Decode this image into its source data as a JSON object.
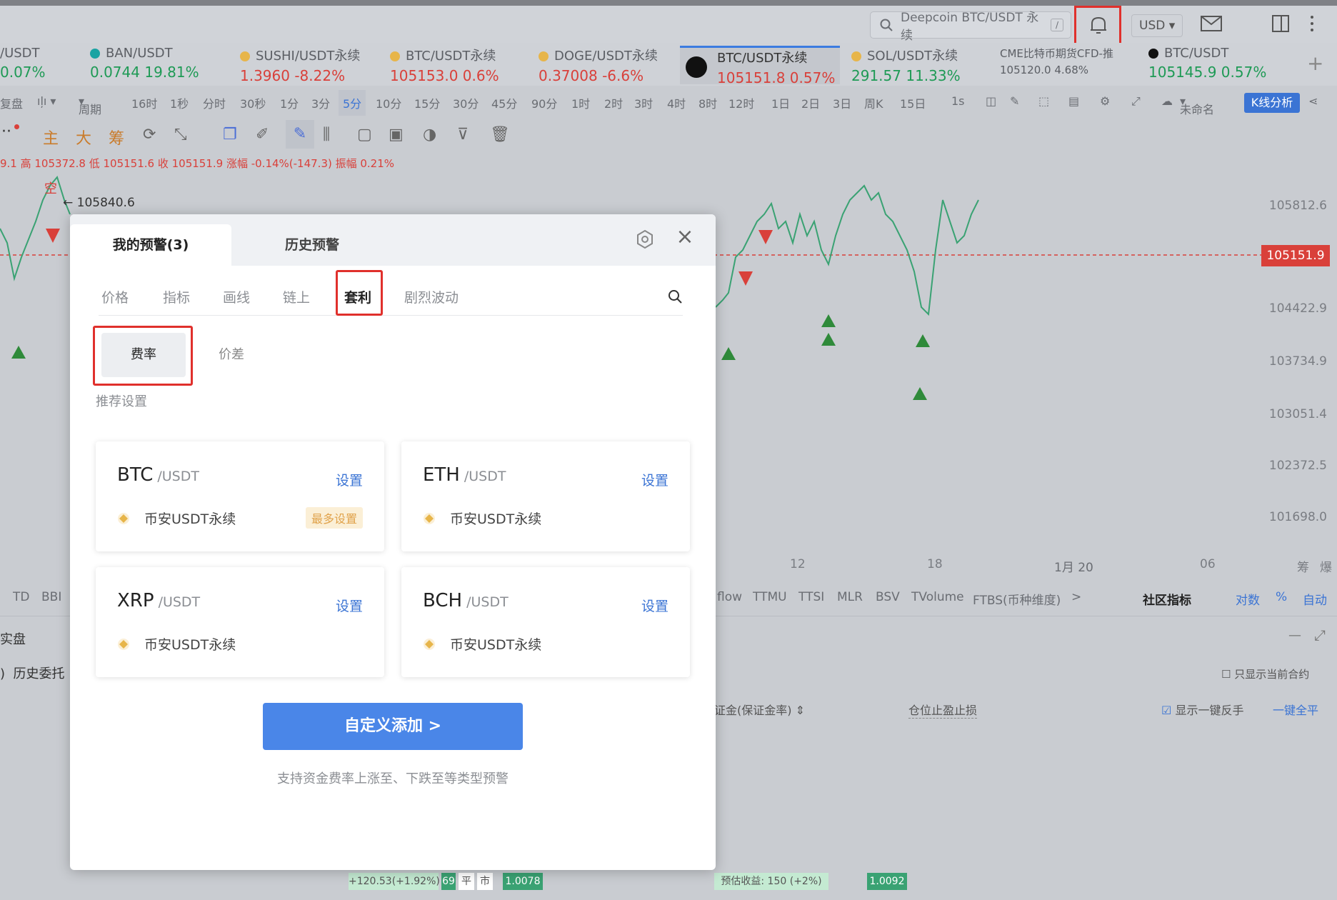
{
  "search": {
    "placeholder": "Deepcoin BTC/USDT 永续",
    "shortcut": "/"
  },
  "currency": "USD",
  "tickers": [
    {
      "name": "/USDT",
      "price": "0.07%",
      "dir": "up"
    },
    {
      "name": "BAN/USDT",
      "price": "0.0744  19.81%",
      "dir": "up"
    },
    {
      "name": "SUSHI/USDT永续",
      "price": "1.3960  -8.22%",
      "dir": "dn"
    },
    {
      "name": "BTC/USDT永续",
      "price": "105153.0  0.6%",
      "dir": "dn"
    },
    {
      "name": "DOGE/USDT永续",
      "price": "0.37008  -6.6%",
      "dir": "dn"
    },
    {
      "name": "BTC/USDT永续",
      "price": "105151.8  0.57%",
      "dir": "dn"
    },
    {
      "name": "SOL/USDT永续",
      "price": "291.57  11.33%",
      "dir": "up"
    },
    {
      "name": "CME比特币期货CFD-推",
      "price": "105120.0  4.68%",
      "dir": "plain"
    },
    {
      "name": "BTC/USDT",
      "price": "105145.9  0.57%",
      "dir": "up"
    }
  ],
  "periods": [
    "复盘",
    "周期",
    "16时",
    "1秒",
    "分时",
    "30秒",
    "1分",
    "3分",
    "5分",
    "10分",
    "15分",
    "30分",
    "45分",
    "90分",
    "1时",
    "2时",
    "3时",
    "4时",
    "8时",
    "12时",
    "1日",
    "2日",
    "3日",
    "周K",
    "15日",
    "1s",
    "未命名",
    "K线分析"
  ],
  "toolbar": [
    "主",
    "大",
    "筹"
  ],
  "ohlc": "9.1  高 105372.8  低 105151.6  收 105151.9  涨幅 -0.14%(-147.3)  振幅 0.21%",
  "chart": {
    "marker_short": "空",
    "marker_price": "← 105840.6",
    "yticks": [
      "105812.6",
      "104422.9",
      "103734.9",
      "103051.4",
      "102372.5",
      "101698.0"
    ],
    "current_price": "105151.9",
    "xticks": [
      "12",
      "18",
      "1月 20",
      "06",
      "筹",
      "爆"
    ]
  },
  "indicators": {
    "left": [
      "TD",
      "BBI"
    ],
    "right": [
      "flow",
      "TTMU",
      "TTSI",
      "MLR",
      "BSV",
      "TVolume",
      "FTBS(币种维度)",
      ">"
    ],
    "tools": [
      "社区指标",
      "对数",
      "%",
      "自动"
    ]
  },
  "panel": {
    "title": "实盘",
    "tab": "历史委托",
    "columns": [
      "证金(保证金率)",
      "仓位止盈止损"
    ],
    "show_current": "只显示当前合约",
    "show_reverse": "显示一键反手",
    "close_all": "一键全平"
  },
  "modal": {
    "tab_my": "我的预警(3)",
    "tab_history": "历史预警",
    "subtabs": [
      "价格",
      "指标",
      "画线",
      "链上",
      "套利",
      "剧烈波动"
    ],
    "pills": [
      "费率",
      "价差"
    ],
    "recommend": "推荐设置",
    "cards": [
      {
        "sym": "BTC",
        "quote": "/USDT",
        "set": "设置",
        "exchange": "币安USDT永续",
        "badge": "最多设置"
      },
      {
        "sym": "ETH",
        "quote": "/USDT",
        "set": "设置",
        "exchange": "币安USDT永续",
        "badge": ""
      },
      {
        "sym": "XRP",
        "quote": "/USDT",
        "set": "设置",
        "exchange": "币安USDT永续",
        "badge": ""
      },
      {
        "sym": "BCH",
        "quote": "/USDT",
        "set": "设置",
        "exchange": "币安USDT永续",
        "badge": ""
      }
    ],
    "add_button": "自定义添加 >",
    "hint": "支持资金费率上涨至、下跌至等类型预警"
  },
  "bottom": {
    "left_tag": "+120.53(+1.92%)",
    "left_num": "69",
    "left_btn1": "平",
    "left_btn2": "市",
    "left_val": "1.0078",
    "right_tag": "预估收益: 150 (+2%)",
    "right_val": "1.0092"
  }
}
